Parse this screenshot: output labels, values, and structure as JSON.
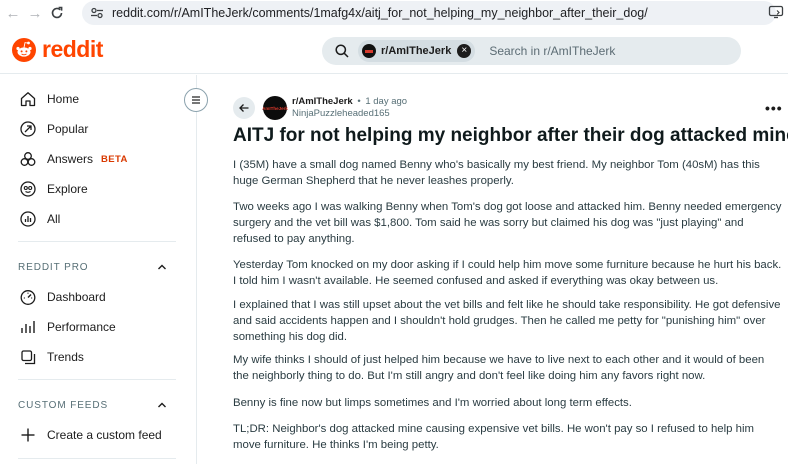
{
  "browser": {
    "url": "reddit.com/r/AmITheJerk/comments/1mafg4x/aitj_for_not_helping_my_neighbor_after_their_dog/"
  },
  "header": {
    "logo_text": "reddit",
    "search_chip": "r/AmITheJerk",
    "search_placeholder": "Search in r/AmITheJerk"
  },
  "sidebar": {
    "items": [
      {
        "label": "Home",
        "icon": "home-icon"
      },
      {
        "label": "Popular",
        "icon": "popular-icon"
      },
      {
        "label": "Answers",
        "badge": "BETA",
        "icon": "answers-icon"
      },
      {
        "label": "Explore",
        "icon": "explore-icon"
      },
      {
        "label": "All",
        "icon": "all-icon"
      }
    ],
    "pro_section": "REDDIT PRO",
    "pro_items": [
      {
        "label": "Dashboard",
        "icon": "dashboard-icon"
      },
      {
        "label": "Performance",
        "icon": "performance-icon"
      },
      {
        "label": "Trends",
        "icon": "trends-icon"
      }
    ],
    "feeds_section": "CUSTOM FEEDS",
    "create_feed": "Create a custom feed"
  },
  "post": {
    "subreddit": "r/AmITheJerk",
    "time": "1 day ago",
    "author": "NinjaPuzzleheaded165",
    "title": "AITJ for not helping my neighbor after their dog attacked mine?",
    "paragraphs": [
      "I (35M) have a small dog named Benny who's basically my best friend. My neighbor Tom (40sM) has this huge German Shepherd that he never leashes properly.",
      "Two weeks ago I was walking Benny when Tom's dog got loose and attacked him. Benny needed emergency surgery and the vet bill was $1,800. Tom said he was sorry but claimed his dog was \"just playing\" and refused to pay anything.",
      "Yesterday Tom knocked on my door asking if I could help him move some furniture because he hurt his back. I told him I wasn't available. He seemed confused and asked if everything was okay between us.",
      "I explained that I was still upset about the vet bills and felt like he should take responsibility. He got defensive and said accidents happen and I shouldn't hold grudges. Then he called me petty for \"punishing him\" over something his dog did.",
      "My wife thinks I should of just helped him because we have to live next to each other and it would of been the neighborly thing to do. But I'm still angry and don't feel like doing him any favors right now.",
      "Benny is fine now but limps sometimes and I'm worried about long term effects.",
      "TL;DR: Neighbor's dog attacked mine causing expensive vet bills. He won't pay so I refused to help him move furniture. He thinks I'm being petty."
    ]
  },
  "colors": {
    "brand": "#ff4500",
    "beta": "#d93900"
  }
}
